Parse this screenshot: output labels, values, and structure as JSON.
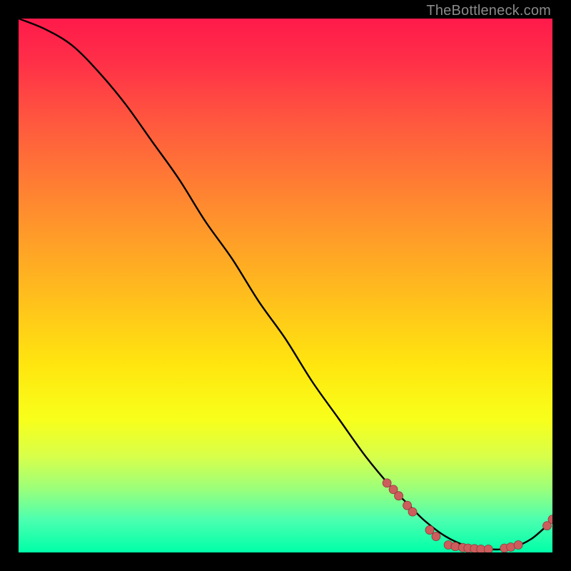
{
  "watermark": "TheBottleneck.com",
  "colors": {
    "curve": "#000000",
    "marker_fill": "#cd5c5c",
    "marker_stroke": "#8b3a3a",
    "background_black": "#000000"
  },
  "chart_data": {
    "type": "line",
    "title": "",
    "xlabel": "",
    "ylabel": "",
    "xlim": [
      0,
      100
    ],
    "ylim": [
      0,
      100
    ],
    "series": [
      {
        "name": "curve",
        "x": [
          0,
          5,
          10,
          15,
          20,
          25,
          30,
          35,
          40,
          45,
          50,
          55,
          60,
          65,
          70,
          73,
          76,
          80,
          84,
          88,
          92,
          96,
          100
        ],
        "y": [
          100,
          98,
          95,
          90,
          84,
          77,
          70,
          62,
          55,
          47,
          40,
          32,
          25,
          18,
          12,
          9,
          6,
          3,
          1.2,
          0.6,
          0.8,
          2.5,
          6
        ]
      }
    ],
    "markers": [
      {
        "x": 69.0,
        "y": 13.0
      },
      {
        "x": 70.2,
        "y": 11.8
      },
      {
        "x": 71.2,
        "y": 10.6
      },
      {
        "x": 72.8,
        "y": 8.8
      },
      {
        "x": 73.8,
        "y": 7.6
      },
      {
        "x": 77.0,
        "y": 4.2
      },
      {
        "x": 78.2,
        "y": 3.0
      },
      {
        "x": 80.5,
        "y": 1.4
      },
      {
        "x": 81.8,
        "y": 1.1
      },
      {
        "x": 83.2,
        "y": 0.9
      },
      {
        "x": 84.2,
        "y": 0.8
      },
      {
        "x": 85.4,
        "y": 0.7
      },
      {
        "x": 86.6,
        "y": 0.6
      },
      {
        "x": 88.0,
        "y": 0.6
      },
      {
        "x": 91.0,
        "y": 0.8
      },
      {
        "x": 92.2,
        "y": 1.0
      },
      {
        "x": 93.6,
        "y": 1.4
      },
      {
        "x": 99.0,
        "y": 5.0
      },
      {
        "x": 100.0,
        "y": 6.2
      }
    ]
  }
}
